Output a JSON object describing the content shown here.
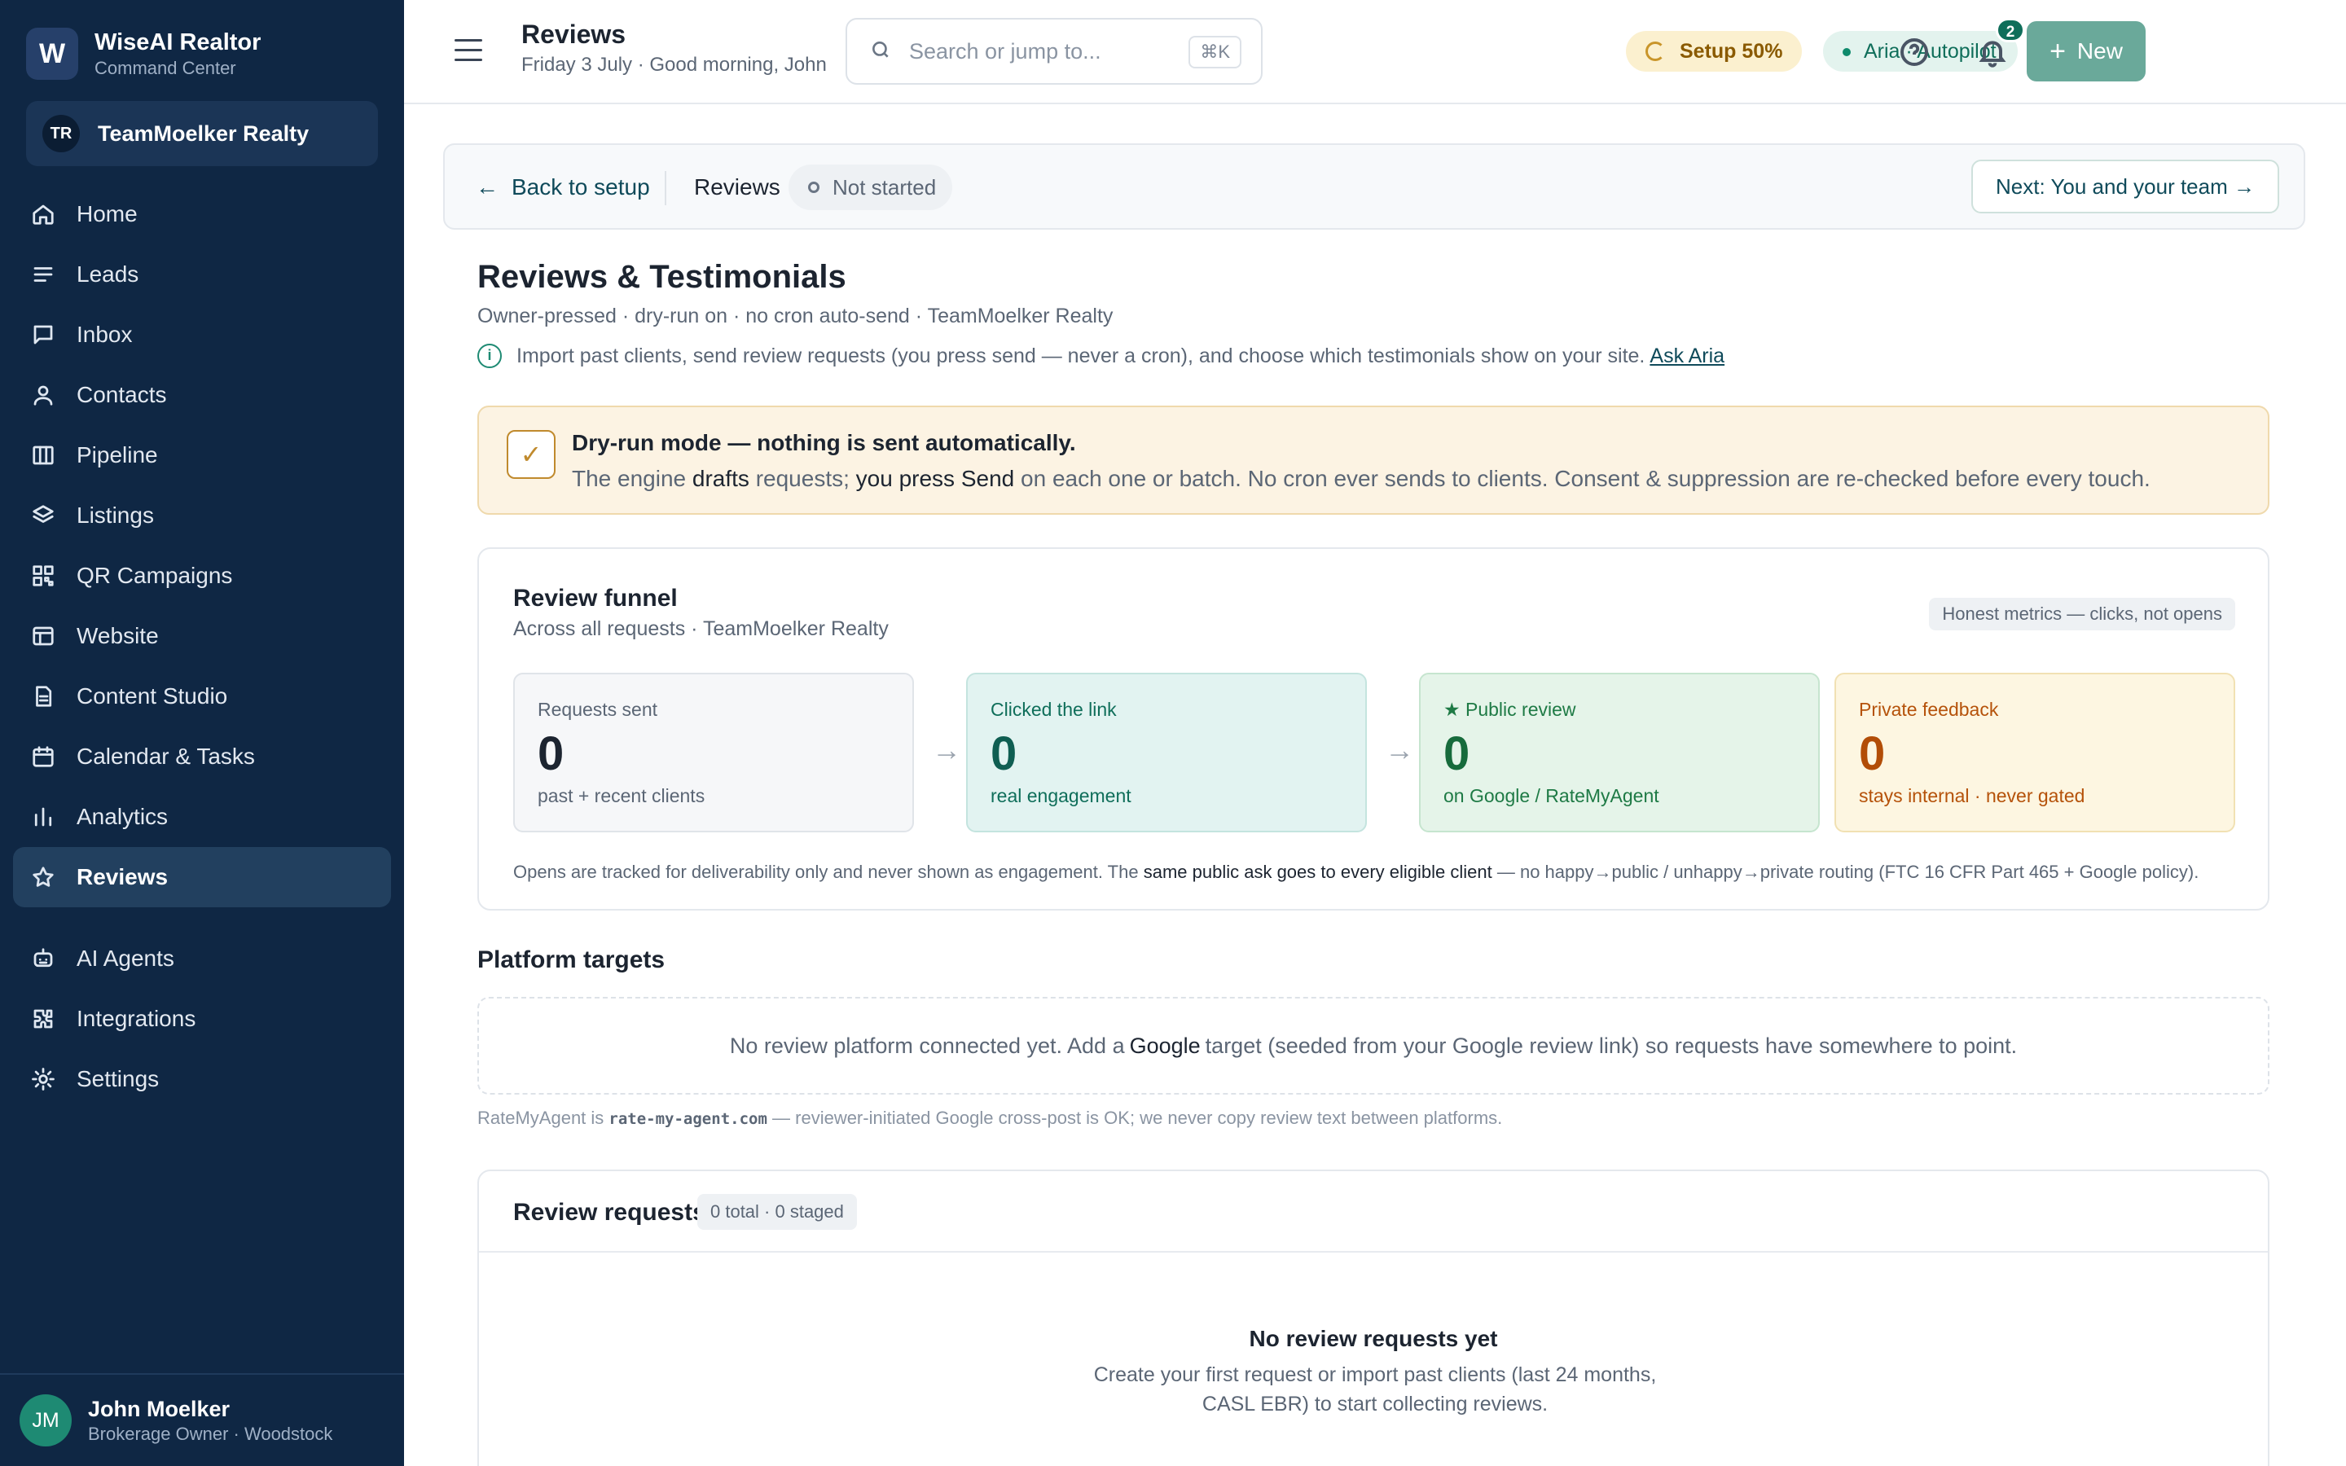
{
  "brand": {
    "logo_letter": "W",
    "name": "WiseAI Realtor",
    "subtitle": "Command Center"
  },
  "team": {
    "initials": "TR",
    "name": "TeamMoelker Realty"
  },
  "nav": {
    "items": [
      {
        "label": "Home",
        "icon": "home-icon"
      },
      {
        "label": "Leads",
        "icon": "list-icon"
      },
      {
        "label": "Inbox",
        "icon": "chat-icon"
      },
      {
        "label": "Contacts",
        "icon": "person-icon"
      },
      {
        "label": "Pipeline",
        "icon": "columns-icon"
      },
      {
        "label": "Listings",
        "icon": "layers-icon"
      },
      {
        "label": "QR Campaigns",
        "icon": "qr-icon"
      },
      {
        "label": "Website",
        "icon": "browser-icon"
      },
      {
        "label": "Content Studio",
        "icon": "document-icon"
      },
      {
        "label": "Calendar & Tasks",
        "icon": "calendar-icon"
      },
      {
        "label": "Analytics",
        "icon": "bar-chart-icon"
      },
      {
        "label": "Reviews",
        "icon": "star-icon",
        "active": true
      }
    ],
    "secondary": [
      {
        "label": "AI Agents",
        "icon": "robot-icon"
      },
      {
        "label": "Integrations",
        "icon": "puzzle-icon"
      },
      {
        "label": "Settings",
        "icon": "gear-icon"
      }
    ]
  },
  "user": {
    "initials": "JM",
    "name": "John Moelker",
    "role": "Brokerage Owner · Woodstock"
  },
  "topbar": {
    "title": "Reviews",
    "subtitle": "Friday 3 July · Good morning, John",
    "search_placeholder": "Search or jump to...",
    "search_shortcut": "⌘K",
    "setup_label": "Setup 50%",
    "aria_label": "Aria · Autopilot",
    "notifications_count": "2",
    "new_label": "New"
  },
  "setupbar": {
    "back_label": "Back to setup",
    "crumb": "Reviews",
    "status": "Not started",
    "next_label": "Next: You and your team"
  },
  "page": {
    "title": "Reviews & Testimonials",
    "subtitle": "Owner-pressed · dry-run on · no cron auto-send · TeamMoelker Realty",
    "info_text": "Import past clients, send review requests (you press send — never a cron), and choose which testimonials show on your site.",
    "info_link": "Ask Aria"
  },
  "dryrun": {
    "title": "Dry-run mode — nothing is sent automatically.",
    "body_1": "The engine",
    "body_drafts": "drafts",
    "body_2": "requests;",
    "body_press": "you press Send",
    "body_3": "on each one or batch. No cron ever sends to clients. Consent & suppression are re-checked before every touch."
  },
  "funnel": {
    "title": "Review funnel",
    "subtitle": "Across all requests · TeamMoelker Realty",
    "badge": "Honest metrics — clicks, not opens",
    "cards": [
      {
        "label": "Requests sent",
        "value": "0",
        "note": "past + recent clients"
      },
      {
        "label": "Clicked the link",
        "value": "0",
        "note": "real engagement"
      },
      {
        "label": "★ Public review",
        "value": "0",
        "note": "on Google / RateMyAgent"
      },
      {
        "label": "Private feedback",
        "value": "0",
        "note": "stays internal · never gated"
      }
    ],
    "arrow": "→",
    "footer_1": "Opens are tracked for deliverability only and never shown as engagement. The",
    "footer_bold": "same public ask goes to every eligible client",
    "footer_2": "— no happy→public / unhappy→private routing (FTC 16 CFR Part 465 + Google policy)."
  },
  "platforms": {
    "title": "Platform targets",
    "empty_1": "No review platform connected yet. Add a",
    "empty_bold": "Google",
    "empty_2": "target (seeded from your Google review link) so requests have somewhere to point.",
    "note_1": "RateMyAgent is",
    "note_code": "rate-my-agent.com",
    "note_2": "— reviewer-initiated Google cross-post is OK; we never copy review text between platforms."
  },
  "requests": {
    "title": "Review requests",
    "count": "0 total · 0 staged",
    "empty_title": "No review requests yet",
    "empty_body": "Create your first request or import past clients (last 24 months, CASL EBR) to start collecting reviews."
  }
}
